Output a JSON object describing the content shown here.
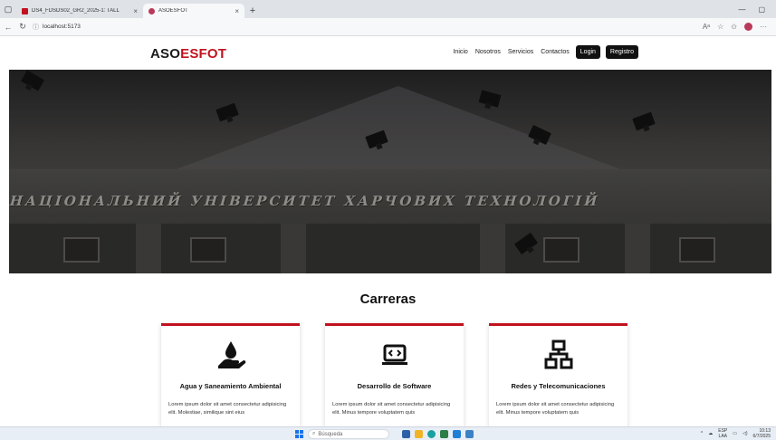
{
  "browser": {
    "tabs": [
      {
        "title": "DS4_FDSDS02_GR2_2025-1: TALL",
        "active": false,
        "favicon_color": "#c1121f"
      },
      {
        "title": "ASOESFOT",
        "active": true,
        "favicon_color": "#b93a5b"
      }
    ],
    "new_tab_label": "+",
    "window_controls": [
      "—",
      "▢"
    ],
    "url": "localhost:5173"
  },
  "site": {
    "logo_part1": "ASO",
    "logo_part2": "ESFOT",
    "nav": {
      "inicio": "Inicio",
      "nosotros": "Nosotros",
      "servicios": "Servicios",
      "contactos": "Contactos",
      "login": "Login",
      "registro": "Registro"
    },
    "hero": {
      "frieze_text": "НАЦІОНАЛЬНИЙ УНІВЕРСИТЕТ ХАРЧОВИХ ТЕХНОЛОГІЙ"
    },
    "section_title": "Carreras",
    "cards": [
      {
        "icon": "hand-water-drop-icon",
        "title": "Agua y Saneamiento Ambiental",
        "text": "Lorem ipsum dolor sit amet consectetur adipisicing elit. Molestiae, similique sint eius"
      },
      {
        "icon": "laptop-code-icon",
        "title": "Desarrollo de Software",
        "text": "Lorem ipsum dolor sit amet consectetur adipisicing elit. Minus tempore voluptatem quis"
      },
      {
        "icon": "network-icon",
        "title": "Redes y Telecomunicaciones",
        "text": "Lorem ipsum dolor sit amet consectetur adipisicing elit. Minus tempore voluptatem quis"
      }
    ]
  },
  "taskbar": {
    "search_placeholder": "Búsqueda",
    "lang": "ESP",
    "lang_sub": "LAA",
    "time": "10:13",
    "date": "6/7/2025"
  },
  "colors": {
    "accent": "#c1121f",
    "button": "#111111"
  }
}
